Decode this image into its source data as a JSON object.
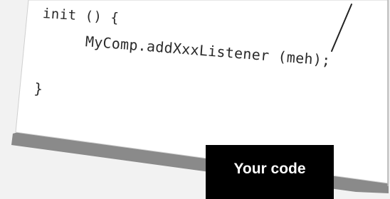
{
  "code": {
    "line1": "init () {",
    "line2": "MyComp.addXxxListener (meh);",
    "line3": "}"
  },
  "label": {
    "text": "Your code"
  },
  "colors": {
    "background": "#f2f2f2",
    "paper": "#ffffff",
    "paper_shadow": "#8a8a8a",
    "label_box": "#000000",
    "label_text": "#ffffff",
    "code_text": "#2a2a2a"
  }
}
